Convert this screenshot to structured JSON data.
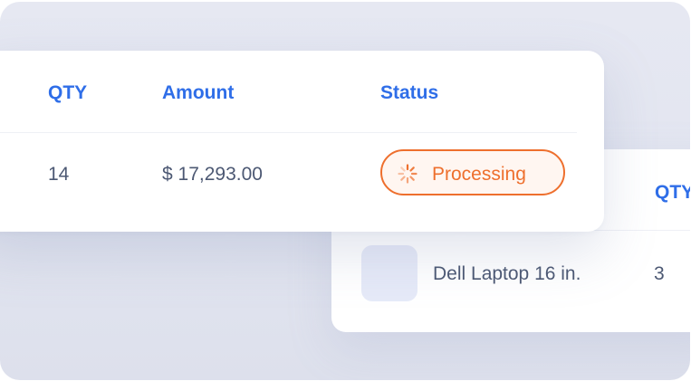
{
  "colors": {
    "accent_blue": "#2f6ee8",
    "text": "#4c5873",
    "status_orange": "#ee6f2d",
    "status_bg": "#fff6f1",
    "panel_bg": "#e4e6f0"
  },
  "order_table": {
    "columns": {
      "qty": "QTY",
      "amount": "Amount",
      "status": "Status"
    },
    "rows": [
      {
        "qty": "14",
        "amount": "$ 17,293.00",
        "status": {
          "label": "Processing",
          "icon": "spinner-icon"
        }
      }
    ]
  },
  "product_table": {
    "columns": {
      "qty": "QTY"
    },
    "rows": [
      {
        "thumbnail": "product-thumbnail",
        "name": "Dell Laptop 16 in.",
        "qty": "3"
      }
    ]
  }
}
